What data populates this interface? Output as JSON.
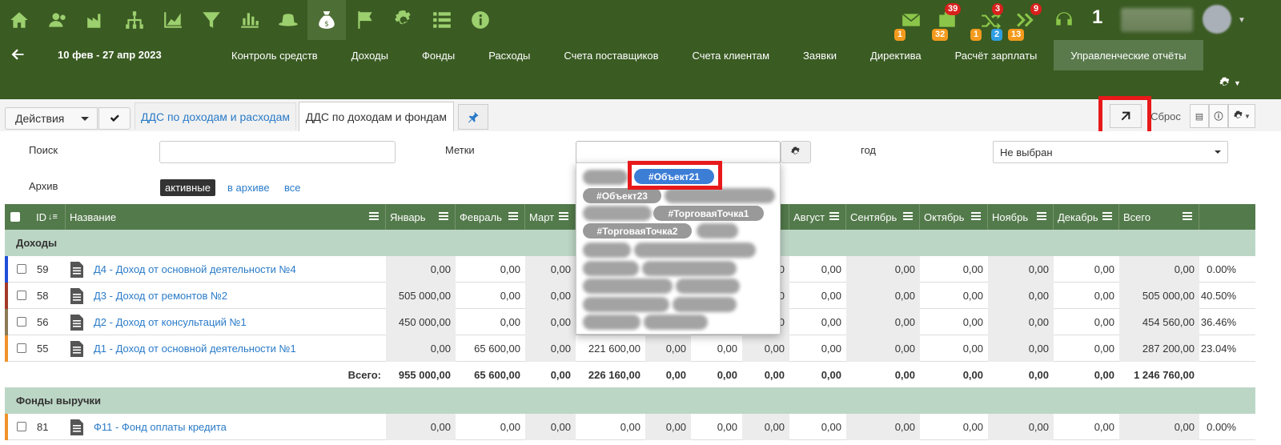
{
  "topnav": {
    "icons": [
      "home-icon",
      "users-icon",
      "factory-icon",
      "org-chart-icon",
      "line-chart-icon",
      "filter-icon",
      "bar-chart-icon",
      "hat-icon",
      "money-bag-icon",
      "flag-icon",
      "gear-icon",
      "list-icon",
      "info-icon"
    ],
    "active_icon": "money-bag-icon",
    "mail_badge": "1",
    "tasks_badge_top": "39",
    "tasks_badge_bottom": "32",
    "shuffle_badge_top": "3",
    "shuffle_badge_left": "1",
    "shuffle_badge_mid": "2",
    "shuffle_badge_right": "13",
    "forward_badge": "9",
    "counter": "1"
  },
  "nav": {
    "date_range": "10 фев - 27 апр 2023",
    "items": [
      "Контроль средств",
      "Доходы",
      "Фонды",
      "Расходы",
      "Счета поставщиков",
      "Счета клиентам",
      "Заявки",
      "Директива",
      "Расчёт зарплаты",
      "Управленческие отчёты"
    ],
    "active": "Управленческие отчёты"
  },
  "toolbar": {
    "actions_label": "Действия",
    "tab1": "ДДС по доходам и расходам",
    "tab2": "ДДС по доходам и фондам",
    "reset_label": "Сброс"
  },
  "filters": {
    "search_label": "Поиск",
    "tags_label": "Метки",
    "year_label": "год",
    "year_value": "Не выбран",
    "archive_label": "Архив",
    "archive_options": [
      "активные",
      "в архиве",
      "все"
    ],
    "archive_active": "активные"
  },
  "tags": {
    "visible": [
      "#Объект21",
      "#Объект23",
      "#ТорговаяТочка1",
      "#ТорговаяТочка2"
    ],
    "selected": "#Объект21"
  },
  "table": {
    "headers": [
      "ID",
      "Название",
      "Январь",
      "Февраль",
      "Март",
      "",
      "",
      "",
      "Август",
      "Сентябрь",
      "Октябрь",
      "Ноябрь",
      "Декабрь",
      "Всего"
    ],
    "section1": "Доходы",
    "rows": [
      {
        "id": "59",
        "name": "Д4 - Доход от основной деятельности №4",
        "jan": "0,00",
        "feb": "0,00",
        "mar": "0,00",
        "c4": "",
        "c5": "",
        "c6": "",
        "c7": "0,00",
        "aug": "0,00",
        "sep": "0,00",
        "oct": "0,00",
        "nov": "0,00",
        "dec": "0,00",
        "total": "0,00",
        "pct": "0.00%",
        "stripe": "#1f4fd8"
      },
      {
        "id": "58",
        "name": "Д3 - Доход от ремонтов №2",
        "jan": "505 000,00",
        "feb": "0,00",
        "mar": "0,00",
        "c4": "",
        "c5": "",
        "c6": "",
        "c7": "0,00",
        "aug": "0,00",
        "sep": "0,00",
        "oct": "0,00",
        "nov": "0,00",
        "dec": "0,00",
        "total": "505 000,00",
        "pct": "40.50%",
        "stripe": "#a33a2a"
      },
      {
        "id": "56",
        "name": "Д2 - Доход от консультаций №1",
        "jan": "450 000,00",
        "feb": "0,00",
        "mar": "0,00",
        "c4": "",
        "c5": "",
        "c6": "",
        "c7": "0,00",
        "aug": "0,00",
        "sep": "0,00",
        "oct": "0,00",
        "nov": "0,00",
        "dec": "0,00",
        "total": "454 560,00",
        "pct": "36.46%",
        "stripe": "#8b7a55"
      },
      {
        "id": "55",
        "name": "Д1 - Доход от основной деятельности №1",
        "jan": "0,00",
        "feb": "65 600,00",
        "mar": "0,00",
        "c4": "221 600,00",
        "c5": "0,00",
        "c6": "0,00",
        "c7": "0,00",
        "aug": "0,00",
        "sep": "0,00",
        "oct": "0,00",
        "nov": "0,00",
        "dec": "0,00",
        "total": "287 200,00",
        "pct": "23.04%",
        "stripe": "#f0922a"
      }
    ],
    "totals": {
      "label": "Всего:",
      "jan": "955 000,00",
      "feb": "65 600,00",
      "mar": "0,00",
      "c4": "226 160,00",
      "c5": "0,00",
      "c6": "0,00",
      "c7": "0,00",
      "aug": "0,00",
      "sep": "0,00",
      "oct": "0,00",
      "nov": "0,00",
      "dec": "0,00",
      "total": "1 246 760,00"
    },
    "section2": "Фонды выручки",
    "row81": {
      "id": "81",
      "name": "Ф11 - Фонд оплаты кредита",
      "jan": "0,00",
      "feb": "0,00",
      "mar": "0,00",
      "c4": "0,00",
      "c5": "0,00",
      "c6": "0,00",
      "c7": "0,00",
      "aug": "0,00",
      "sep": "0,00",
      "oct": "0,00",
      "nov": "0,00",
      "dec": "0,00",
      "total": "0,00",
      "pct": "0.00%",
      "stripe": "#f0922a"
    }
  }
}
